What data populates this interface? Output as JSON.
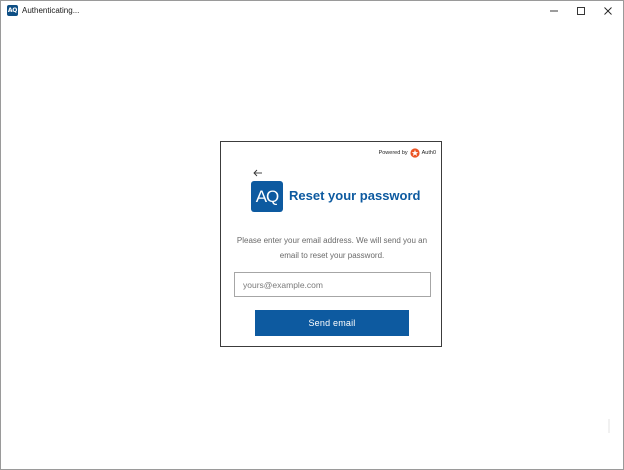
{
  "window": {
    "title": "Authenticating...",
    "app_icon_text": "AQ",
    "icons": [
      "minimize-icon",
      "maximize-icon",
      "close-icon"
    ]
  },
  "card": {
    "powered_by_label": "Powered by",
    "powered_by_brand": "Auth0",
    "back_icon": "arrow-left-icon",
    "logo_text": "AQ",
    "title": "Reset your password",
    "description": "Please enter your email address. We will send you an email to reset your password.",
    "email_placeholder": "yours@example.com",
    "email_value": "",
    "send_button_label": "Send email"
  },
  "colors": {
    "brand": "#0d5aa0",
    "title_text": "#0d5aa0",
    "description_text": "#6a6a6a",
    "auth0_accent": "#eb5424"
  }
}
